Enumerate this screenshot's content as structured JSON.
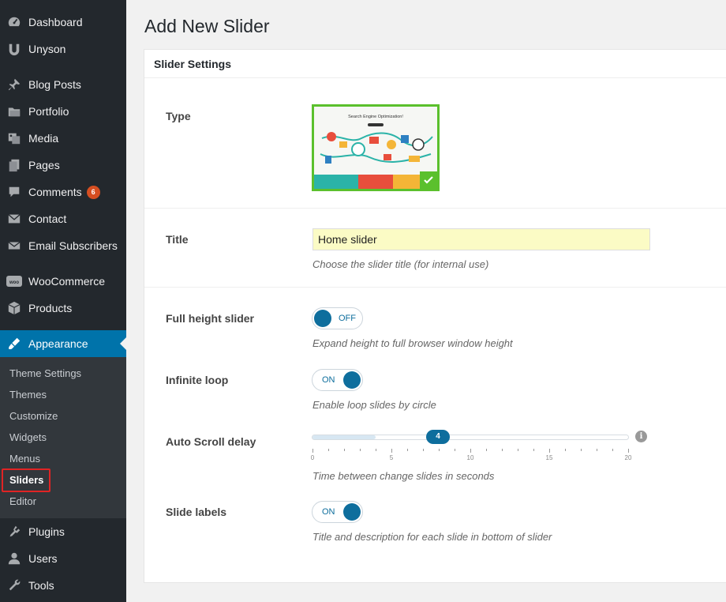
{
  "sidebar": {
    "items": [
      {
        "label": "Dashboard",
        "icon": "dashboard-icon"
      },
      {
        "label": "Unyson",
        "icon": "unyson-icon"
      },
      {
        "label": "Blog Posts",
        "icon": "pin-icon"
      },
      {
        "label": "Portfolio",
        "icon": "portfolio-icon"
      },
      {
        "label": "Media",
        "icon": "media-icon"
      },
      {
        "label": "Pages",
        "icon": "pages-icon"
      },
      {
        "label": "Comments",
        "icon": "comments-icon",
        "badge": "6"
      },
      {
        "label": "Contact",
        "icon": "mail-icon"
      },
      {
        "label": "Email Subscribers",
        "icon": "mail-icon"
      },
      {
        "label": "WooCommerce",
        "icon": "woocommerce-icon"
      },
      {
        "label": "Products",
        "icon": "products-icon"
      },
      {
        "label": "Appearance",
        "icon": "appearance-icon",
        "active": true
      },
      {
        "label": "Plugins",
        "icon": "plugins-icon"
      },
      {
        "label": "Users",
        "icon": "users-icon"
      },
      {
        "label": "Tools",
        "icon": "tools-icon"
      }
    ],
    "submenu": [
      "Theme Settings",
      "Themes",
      "Customize",
      "Widgets",
      "Menus",
      "Sliders",
      "Editor"
    ],
    "submenu_current": "Sliders"
  },
  "page_title": "Add New Slider",
  "panel": {
    "header": "Slider Settings",
    "type": {
      "label": "Type",
      "thumbnail_heading": "Search Engine Optimization!",
      "selected": true
    },
    "title": {
      "label": "Title",
      "value": "Home slider",
      "description": "Choose the slider title (for internal use)"
    },
    "full_height": {
      "label": "Full height slider",
      "state": "OFF",
      "description": "Expand height to full browser window height"
    },
    "infinite_loop": {
      "label": "Infinite loop",
      "state": "ON",
      "description": "Enable loop slides by circle"
    },
    "auto_scroll": {
      "label": "Auto Scroll delay",
      "value": "4",
      "min": 0,
      "max": 20,
      "tick_labels": [
        "0",
        "5",
        "10",
        "15",
        "20"
      ],
      "description": "Time between change slides in seconds"
    },
    "slide_labels": {
      "label": "Slide labels",
      "state": "ON",
      "description": "Title and description for each slide in bottom of slider"
    }
  },
  "colors": {
    "sidebar_bg": "#23282d",
    "submenu_bg": "#32373c",
    "active_blue": "#0073aa",
    "toggle_blue": "#0e6e9d",
    "badge_orange": "#d54e21",
    "selected_green": "#5bc02d",
    "highlight_red": "#e02424",
    "input_yellow": "#fbfbc5"
  }
}
